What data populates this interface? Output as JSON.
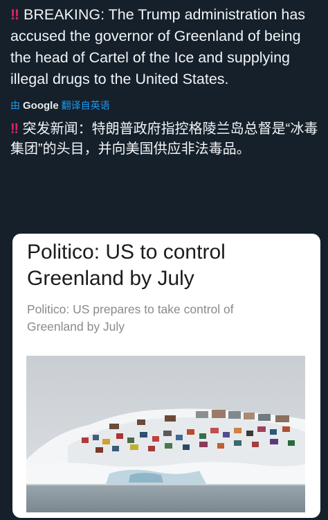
{
  "post": {
    "alert_icon": "double-exclamation-icon",
    "text_en": "BREAKING: The Trump administration has accused the governor of Greenland of being the head of Cartel of the Ice and supplying illegal drugs to the United States.",
    "translation": {
      "by": "由",
      "provider": "Google",
      "label": "翻译自英语"
    },
    "text_zh": "突发新闻：特朗普政府指控格陵兰岛总督是“冰毒集团”的头目，并向美国供应非法毒品。"
  },
  "link_card": {
    "title": "Politico: US to control Greenland by July",
    "subtitle": "Politico: US prepares to take control of Greenland by July"
  },
  "colors": {
    "background": "#15202b",
    "alert": "#e0245e",
    "link": "#1d9bf0",
    "card": "#ffffff"
  }
}
